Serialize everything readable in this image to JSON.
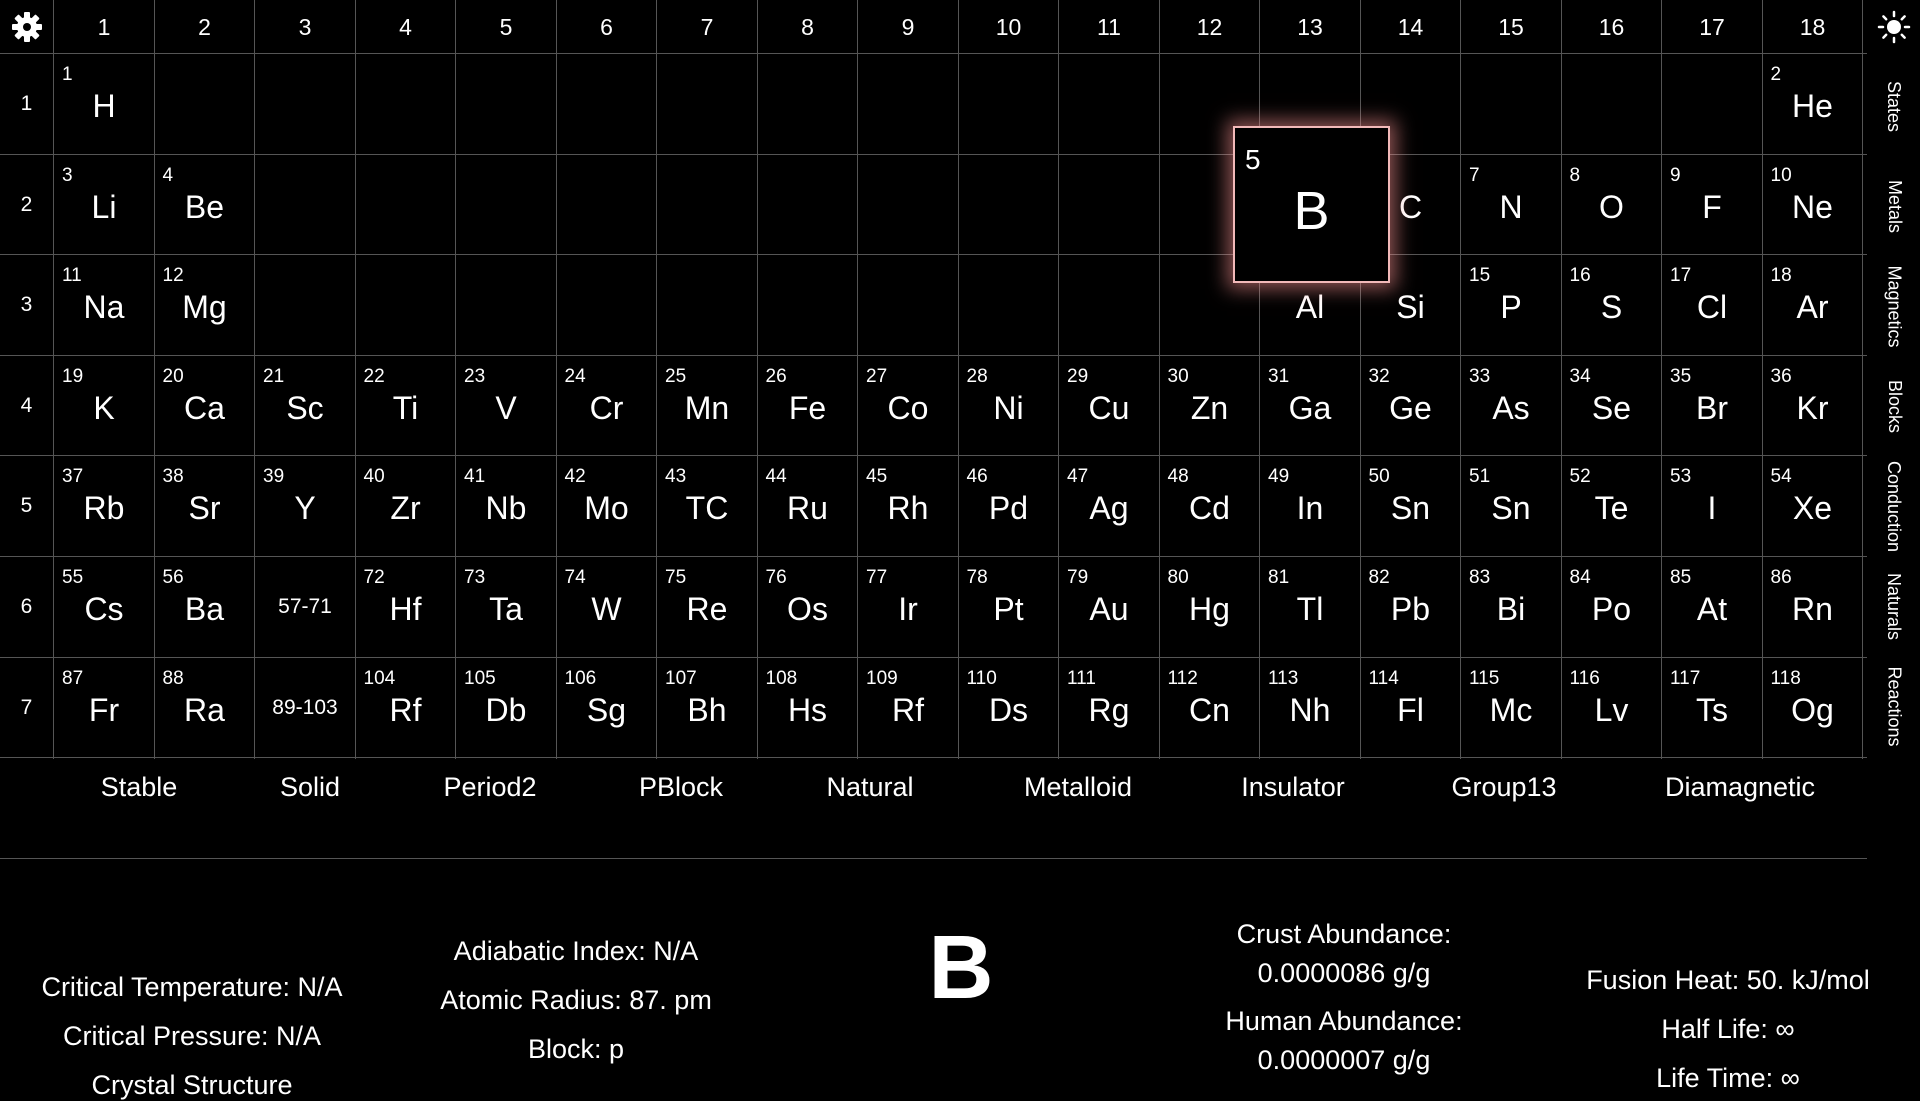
{
  "columns": [
    "1",
    "2",
    "3",
    "4",
    "5",
    "6",
    "7",
    "8",
    "9",
    "10",
    "11",
    "12",
    "13",
    "14",
    "15",
    "16",
    "17",
    "18"
  ],
  "periods": [
    "1",
    "2",
    "3",
    "4",
    "5",
    "6",
    "7"
  ],
  "elements": [
    {
      "period": 1,
      "group": 1,
      "number": "1",
      "symbol": "H"
    },
    {
      "period": 1,
      "group": 18,
      "number": "2",
      "symbol": "He"
    },
    {
      "period": 2,
      "group": 1,
      "number": "3",
      "symbol": "Li"
    },
    {
      "period": 2,
      "group": 2,
      "number": "4",
      "symbol": "Be"
    },
    {
      "period": 2,
      "group": 14,
      "number": "",
      "symbol": "C"
    },
    {
      "period": 2,
      "group": 15,
      "number": "7",
      "symbol": "N"
    },
    {
      "period": 2,
      "group": 16,
      "number": "8",
      "symbol": "O"
    },
    {
      "period": 2,
      "group": 17,
      "number": "9",
      "symbol": "F"
    },
    {
      "period": 2,
      "group": 18,
      "number": "10",
      "symbol": "Ne"
    },
    {
      "period": 3,
      "group": 1,
      "number": "11",
      "symbol": "Na"
    },
    {
      "period": 3,
      "group": 2,
      "number": "12",
      "symbol": "Mg"
    },
    {
      "period": 3,
      "group": 13,
      "number": "",
      "symbol": "Al"
    },
    {
      "period": 3,
      "group": 14,
      "number": "",
      "symbol": "Si"
    },
    {
      "period": 3,
      "group": 15,
      "number": "15",
      "symbol": "P"
    },
    {
      "period": 3,
      "group": 16,
      "number": "16",
      "symbol": "S"
    },
    {
      "period": 3,
      "group": 17,
      "number": "17",
      "symbol": "Cl"
    },
    {
      "period": 3,
      "group": 18,
      "number": "18",
      "symbol": "Ar"
    },
    {
      "period": 4,
      "group": 1,
      "number": "19",
      "symbol": "K"
    },
    {
      "period": 4,
      "group": 2,
      "number": "20",
      "symbol": "Ca"
    },
    {
      "period": 4,
      "group": 3,
      "number": "21",
      "symbol": "Sc"
    },
    {
      "period": 4,
      "group": 4,
      "number": "22",
      "symbol": "Ti"
    },
    {
      "period": 4,
      "group": 5,
      "number": "23",
      "symbol": "V"
    },
    {
      "period": 4,
      "group": 6,
      "number": "24",
      "symbol": "Cr"
    },
    {
      "period": 4,
      "group": 7,
      "number": "25",
      "symbol": "Mn"
    },
    {
      "period": 4,
      "group": 8,
      "number": "26",
      "symbol": "Fe"
    },
    {
      "period": 4,
      "group": 9,
      "number": "27",
      "symbol": "Co"
    },
    {
      "period": 4,
      "group": 10,
      "number": "28",
      "symbol": "Ni"
    },
    {
      "period": 4,
      "group": 11,
      "number": "29",
      "symbol": "Cu"
    },
    {
      "period": 4,
      "group": 12,
      "number": "30",
      "symbol": "Zn"
    },
    {
      "period": 4,
      "group": 13,
      "number": "31",
      "symbol": "Ga"
    },
    {
      "period": 4,
      "group": 14,
      "number": "32",
      "symbol": "Ge"
    },
    {
      "period": 4,
      "group": 15,
      "number": "33",
      "symbol": "As"
    },
    {
      "period": 4,
      "group": 16,
      "number": "34",
      "symbol": "Se"
    },
    {
      "period": 4,
      "group": 17,
      "number": "35",
      "symbol": "Br"
    },
    {
      "period": 4,
      "group": 18,
      "number": "36",
      "symbol": "Kr"
    },
    {
      "period": 5,
      "group": 1,
      "number": "37",
      "symbol": "Rb"
    },
    {
      "period": 5,
      "group": 2,
      "number": "38",
      "symbol": "Sr"
    },
    {
      "period": 5,
      "group": 3,
      "number": "39",
      "symbol": "Y"
    },
    {
      "period": 5,
      "group": 4,
      "number": "40",
      "symbol": "Zr"
    },
    {
      "period": 5,
      "group": 5,
      "number": "41",
      "symbol": "Nb"
    },
    {
      "period": 5,
      "group": 6,
      "number": "42",
      "symbol": "Mo"
    },
    {
      "period": 5,
      "group": 7,
      "number": "43",
      "symbol": "TC"
    },
    {
      "period": 5,
      "group": 8,
      "number": "44",
      "symbol": "Ru"
    },
    {
      "period": 5,
      "group": 9,
      "number": "45",
      "symbol": "Rh"
    },
    {
      "period": 5,
      "group": 10,
      "number": "46",
      "symbol": "Pd"
    },
    {
      "period": 5,
      "group": 11,
      "number": "47",
      "symbol": "Ag"
    },
    {
      "period": 5,
      "group": 12,
      "number": "48",
      "symbol": "Cd"
    },
    {
      "period": 5,
      "group": 13,
      "number": "49",
      "symbol": "In"
    },
    {
      "period": 5,
      "group": 14,
      "number": "50",
      "symbol": "Sn"
    },
    {
      "period": 5,
      "group": 15,
      "number": "51",
      "symbol": "Sn"
    },
    {
      "period": 5,
      "group": 16,
      "number": "52",
      "symbol": "Te"
    },
    {
      "period": 5,
      "group": 17,
      "number": "53",
      "symbol": "I"
    },
    {
      "period": 5,
      "group": 18,
      "number": "54",
      "symbol": "Xe"
    },
    {
      "period": 6,
      "group": 1,
      "number": "55",
      "symbol": "Cs"
    },
    {
      "period": 6,
      "group": 2,
      "number": "56",
      "symbol": "Ba"
    },
    {
      "period": 6,
      "group": 3,
      "number": "",
      "symbol": "",
      "range": "57-71"
    },
    {
      "period": 6,
      "group": 4,
      "number": "72",
      "symbol": "Hf"
    },
    {
      "period": 6,
      "group": 5,
      "number": "73",
      "symbol": "Ta"
    },
    {
      "period": 6,
      "group": 6,
      "number": "74",
      "symbol": "W"
    },
    {
      "period": 6,
      "group": 7,
      "number": "75",
      "symbol": "Re"
    },
    {
      "period": 6,
      "group": 8,
      "number": "76",
      "symbol": "Os"
    },
    {
      "period": 6,
      "group": 9,
      "number": "77",
      "symbol": "Ir"
    },
    {
      "period": 6,
      "group": 10,
      "number": "78",
      "symbol": "Pt"
    },
    {
      "period": 6,
      "group": 11,
      "number": "79",
      "symbol": "Au"
    },
    {
      "period": 6,
      "group": 12,
      "number": "80",
      "symbol": "Hg"
    },
    {
      "period": 6,
      "group": 13,
      "number": "81",
      "symbol": "Tl"
    },
    {
      "period": 6,
      "group": 14,
      "number": "82",
      "symbol": "Pb"
    },
    {
      "period": 6,
      "group": 15,
      "number": "83",
      "symbol": "Bi"
    },
    {
      "period": 6,
      "group": 16,
      "number": "84",
      "symbol": "Po"
    },
    {
      "period": 6,
      "group": 17,
      "number": "85",
      "symbol": "At"
    },
    {
      "period": 6,
      "group": 18,
      "number": "86",
      "symbol": "Rn"
    },
    {
      "period": 7,
      "group": 1,
      "number": "87",
      "symbol": "Fr"
    },
    {
      "period": 7,
      "group": 2,
      "number": "88",
      "symbol": "Ra"
    },
    {
      "period": 7,
      "group": 3,
      "number": "",
      "symbol": "",
      "range": "89-103"
    },
    {
      "period": 7,
      "group": 4,
      "number": "104",
      "symbol": "Rf"
    },
    {
      "period": 7,
      "group": 5,
      "number": "105",
      "symbol": "Db"
    },
    {
      "period": 7,
      "group": 6,
      "number": "106",
      "symbol": "Sg"
    },
    {
      "period": 7,
      "group": 7,
      "number": "107",
      "symbol": "Bh"
    },
    {
      "period": 7,
      "group": 8,
      "number": "108",
      "symbol": "Hs"
    },
    {
      "period": 7,
      "group": 9,
      "number": "109",
      "symbol": "Rf"
    },
    {
      "period": 7,
      "group": 10,
      "number": "110",
      "symbol": "Ds"
    },
    {
      "period": 7,
      "group": 11,
      "number": "111",
      "symbol": "Rg"
    },
    {
      "period": 7,
      "group": 12,
      "number": "112",
      "symbol": "Cn"
    },
    {
      "period": 7,
      "group": 13,
      "number": "113",
      "symbol": "Nh"
    },
    {
      "period": 7,
      "group": 14,
      "number": "114",
      "symbol": "Fl"
    },
    {
      "period": 7,
      "group": 15,
      "number": "115",
      "symbol": "Mc"
    },
    {
      "period": 7,
      "group": 16,
      "number": "116",
      "symbol": "Lv"
    },
    {
      "period": 7,
      "group": 17,
      "number": "117",
      "symbol": "Ts"
    },
    {
      "period": 7,
      "group": 18,
      "number": "118",
      "symbol": "Og"
    }
  ],
  "selected": {
    "number": "5",
    "symbol": "B",
    "highlight_color": "#f2b9b9"
  },
  "icons": {
    "settings": "gear-icon",
    "theme": "sun-icon"
  },
  "side_tabs": [
    "States",
    "Metals",
    "Magnetics",
    "Blocks",
    "Conduction",
    "Naturals",
    "Reactions"
  ],
  "tags": [
    "Stable",
    "Solid",
    "Period2",
    "PBlock",
    "Natural",
    "Metalloid",
    "Insulator",
    "Group13",
    "Diamagnetic"
  ],
  "details": {
    "critical_temperature": "Critical Temperature: N/A",
    "critical_pressure": "Critical Pressure: N/A",
    "crystal_structure": "Crystal Structure",
    "adiabatic_index": "Adiabatic Index: N/A",
    "atomic_radius": "Atomic Radius: 87. pm",
    "block": "Block: p",
    "symbol": "B",
    "crust_abundance_label": "Crust Abundance:",
    "crust_abundance_value": "0.0000086 g/g",
    "human_abundance_label": "Human Abundance:",
    "human_abundance_value": "0.0000007 g/g",
    "fusion_heat": "Fusion Heat: 50. kJ/mol",
    "half_life": "Half Life: ∞",
    "life_time": "Life Time: ∞"
  }
}
